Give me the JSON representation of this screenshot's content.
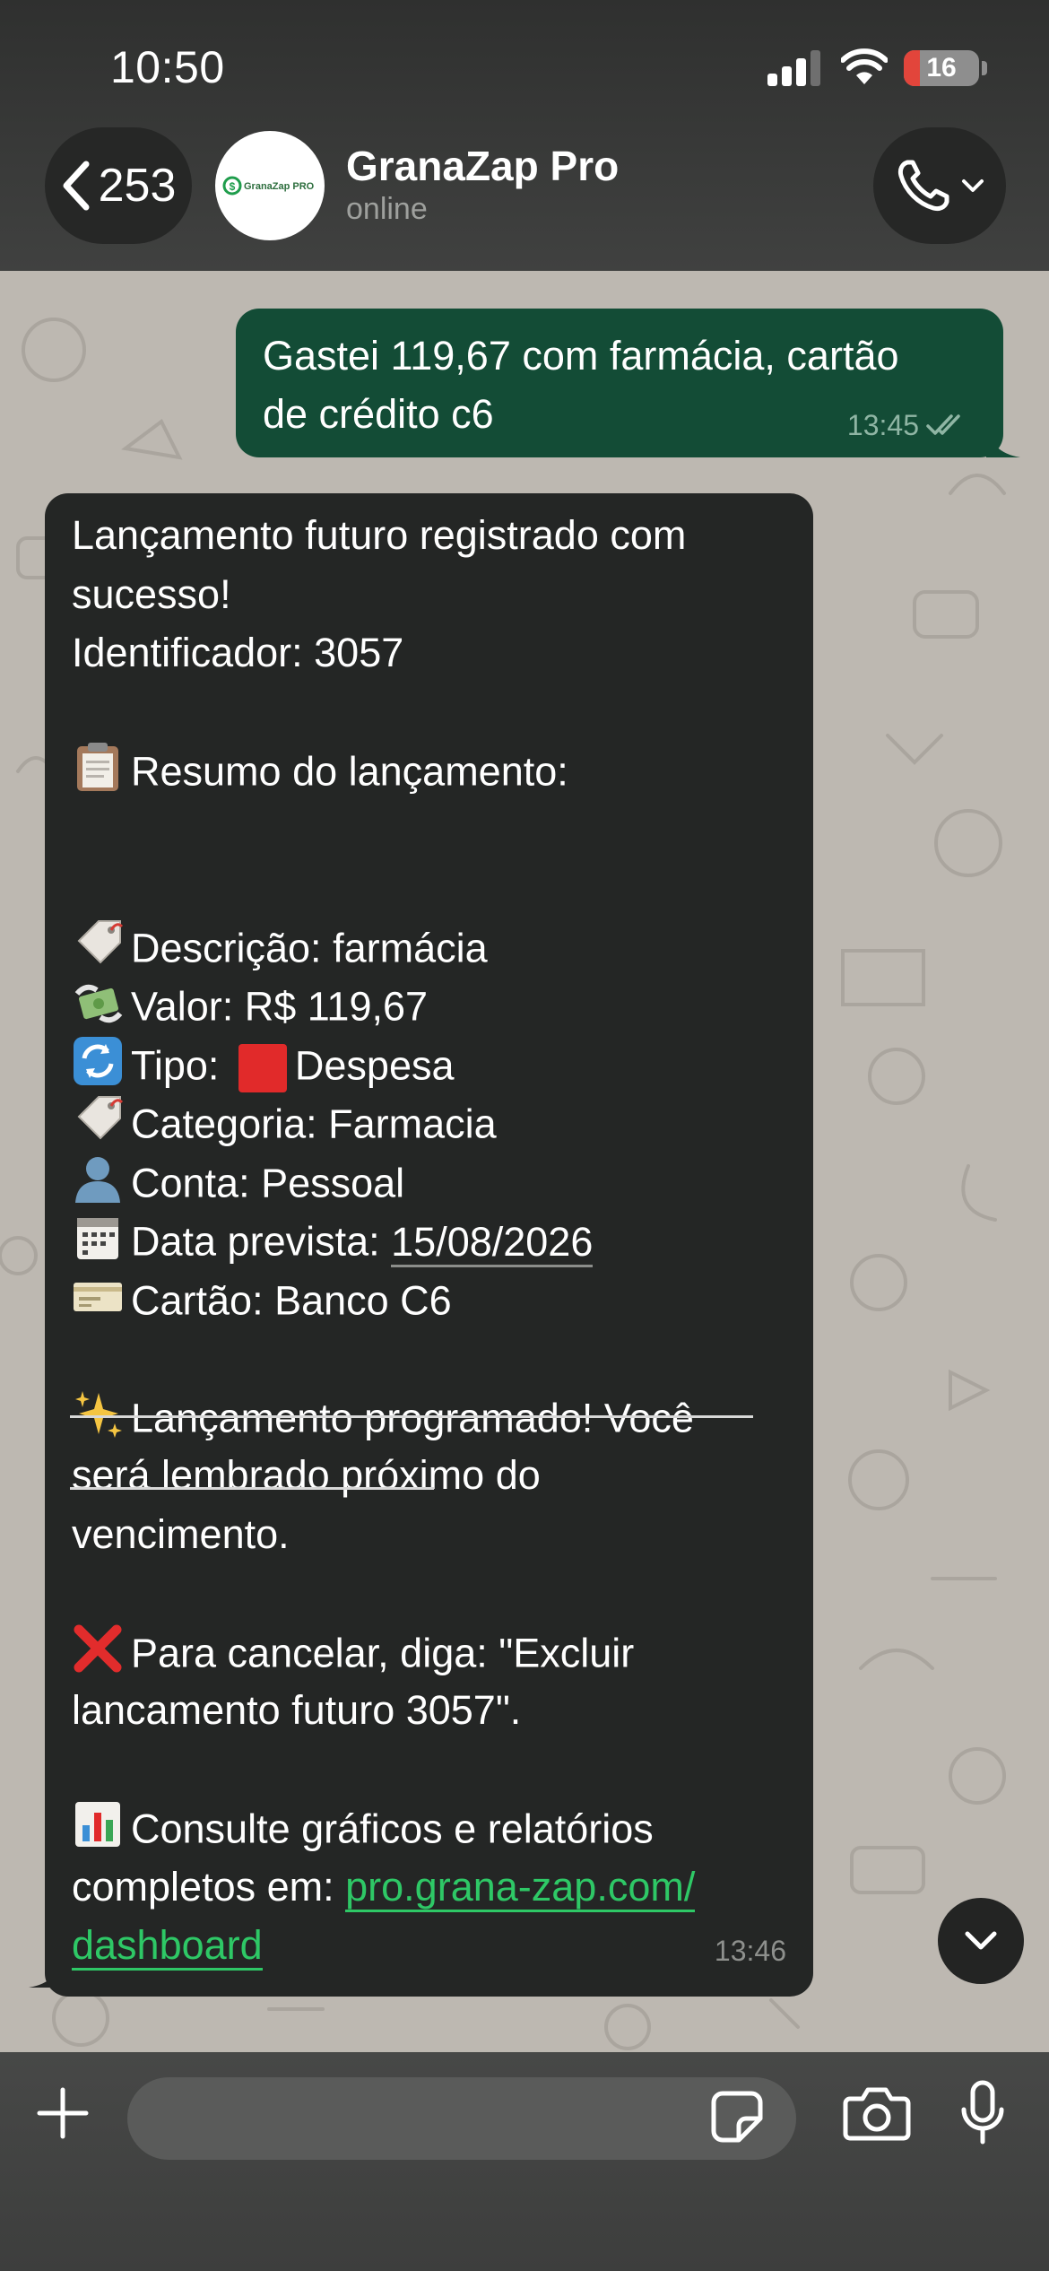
{
  "status_bar": {
    "time": "10:50",
    "battery": "16"
  },
  "header": {
    "back_count": "253",
    "contact_name": "GranaZap Pro",
    "contact_status": "online",
    "avatar_text": "GranaZap PRO"
  },
  "messages": [
    {
      "direction": "out",
      "lines": [
        "Gastei 119,67 com farmácia, cartão",
        "de crédito c6"
      ],
      "time": "13:45"
    },
    {
      "direction": "in",
      "time": "13:46",
      "title_lines": [
        "Lançamento futuro registrado com",
        "sucesso!",
        "Identificador: 3057"
      ],
      "summary_heading": "Resumo do lançamento:",
      "fields": {
        "descricao": "Descrição: farmácia",
        "valor": "Valor: R$ 119,67",
        "tipo_prefix": "Tipo:",
        "tipo_value": "Despesa",
        "categoria": "Categoria: Farmacia",
        "conta": "Conta: Pessoal",
        "data_label": "Data prevista:",
        "data_value": "15/08/2026",
        "cartao": "Cartão: Banco C6"
      },
      "scheduled_lines": [
        "Lançamento programado! Você",
        "será lembrado próximo do",
        "vencimento."
      ],
      "cancel_lines": [
        "Para cancelar, diga: \"Excluir",
        "lancamento futuro 3057\"."
      ],
      "report_lines": [
        "Consulte gráficos e relatórios",
        "completos em:"
      ],
      "link_part1": "pro.grana-zap.com/",
      "link_part2": "dashboard"
    }
  ],
  "colors": {
    "accent_green": "#2ec866",
    "bubble_out": "#134c36",
    "bubble_in": "#242625"
  },
  "icons": [
    "back-chevron-icon",
    "phone-icon",
    "plus-icon",
    "sticker-icon",
    "camera-icon",
    "mic-icon",
    "scroll-down-icon",
    "read-receipt-icon"
  ]
}
